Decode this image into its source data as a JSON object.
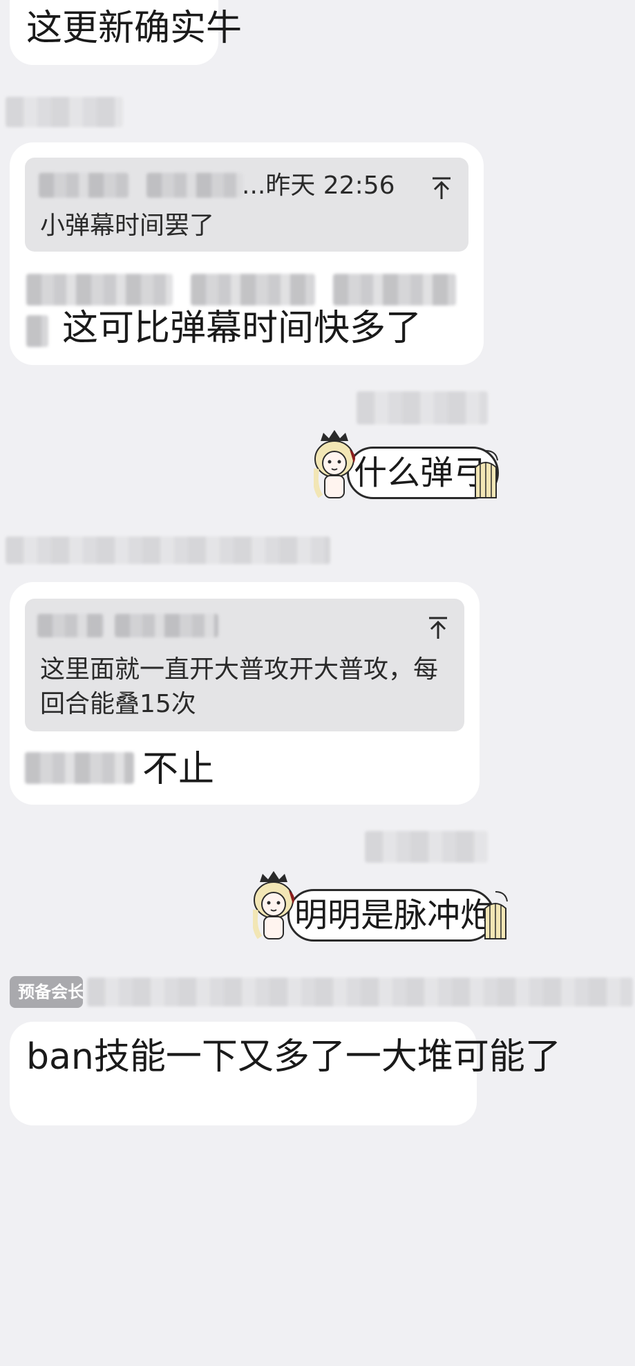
{
  "messages": {
    "m1": {
      "text": "这更新确实牛"
    },
    "m2": {
      "quote": {
        "header_suffix": "...昨天 22:56",
        "text": "小弹幕时间罢了"
      },
      "text": "这可比弹幕时间快多了"
    },
    "m3": {
      "sticker_text": "什么弹弓"
    },
    "m4": {
      "quote": {
        "text": "这里面就一直开大普攻开大普攻，每回合能叠15次"
      },
      "text": "不止"
    },
    "m5": {
      "sticker_text": "明明是脉冲炮"
    },
    "m6": {
      "badge": "预备会长",
      "text": "ban技能一下又多了一大堆可能了"
    }
  },
  "icons": {
    "jump_to_quote": "arrow-up-to-line-icon",
    "sticker_character": "anime-girl-sticker-icon",
    "sticker_cage": "birdcage-icon"
  },
  "colors": {
    "background": "#f0f0f3",
    "bubble": "#ffffff",
    "quote_background": "#e4e4e6",
    "badge": "#a9a9ad"
  }
}
